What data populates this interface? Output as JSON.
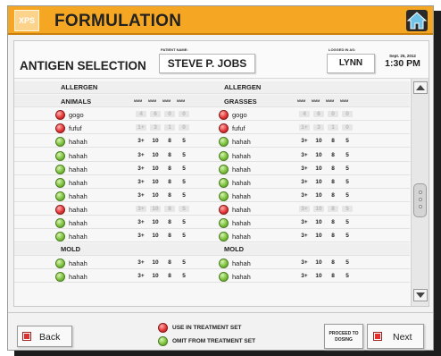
{
  "app": {
    "title": "FORMULATION",
    "logo": "XPS",
    "home_icon": "home-icon",
    "accent": "#f5a623"
  },
  "info": {
    "screen_title": "ANTIGEN SELECTION",
    "patient_label": "PATIENT NAME:",
    "patient_name": "STEVE P. JOBS",
    "login_label": "LOGGED IN AS:",
    "user": "LYNN",
    "date": "Sept. 25, 2012",
    "time": "1:30 PM"
  },
  "groups": [
    {
      "left": "ALLERGEN",
      "right": "ALLERGEN"
    },
    {
      "left": "MOLD",
      "right": "MOLD"
    }
  ],
  "categories": {
    "left": "ANIMALS",
    "right": "GRASSES",
    "columns": [
      "MMM",
      "MMM",
      "MMM",
      "MMM"
    ]
  },
  "rows_left": [
    {
      "status": "red",
      "name": "gogo",
      "values": [
        "4",
        "6",
        "0",
        "0"
      ],
      "dim": true
    },
    {
      "status": "red",
      "name": "fufuf",
      "values": [
        "1+",
        "3",
        "1",
        "0"
      ],
      "dim": true
    },
    {
      "status": "green",
      "name": "hahah",
      "values": [
        "3+",
        "10",
        "8",
        "5"
      ],
      "dim": false
    },
    {
      "status": "green",
      "name": "hahah",
      "values": [
        "3+",
        "10",
        "8",
        "5"
      ],
      "dim": false
    },
    {
      "status": "green",
      "name": "hahah",
      "values": [
        "3+",
        "10",
        "8",
        "5"
      ],
      "dim": false
    },
    {
      "status": "green",
      "name": "hahah",
      "values": [
        "3+",
        "10",
        "8",
        "5"
      ],
      "dim": false
    },
    {
      "status": "green",
      "name": "hahah",
      "values": [
        "3+",
        "10",
        "8",
        "5"
      ],
      "dim": false
    },
    {
      "status": "red",
      "name": "hahah",
      "values": [
        "3+",
        "10",
        "8",
        "5"
      ],
      "dim": true
    },
    {
      "status": "green",
      "name": "hahah",
      "values": [
        "3+",
        "10",
        "8",
        "5"
      ],
      "dim": false
    },
    {
      "status": "green",
      "name": "hahah",
      "values": [
        "3+",
        "10",
        "8",
        "5"
      ],
      "dim": false
    }
  ],
  "rows_right": [
    {
      "status": "red",
      "name": "gogo",
      "values": [
        "4",
        "6",
        "0",
        "0"
      ],
      "dim": true
    },
    {
      "status": "red",
      "name": "fufuf",
      "values": [
        "1+",
        "3",
        "1",
        "0"
      ],
      "dim": true
    },
    {
      "status": "green",
      "name": "hahah",
      "values": [
        "3+",
        "10",
        "8",
        "5"
      ],
      "dim": false
    },
    {
      "status": "green",
      "name": "hahah",
      "values": [
        "3+",
        "10",
        "8",
        "5"
      ],
      "dim": false
    },
    {
      "status": "green",
      "name": "hahah",
      "values": [
        "3+",
        "10",
        "8",
        "5"
      ],
      "dim": false
    },
    {
      "status": "green",
      "name": "hahah",
      "values": [
        "3+",
        "10",
        "8",
        "5"
      ],
      "dim": false
    },
    {
      "status": "green",
      "name": "hahah",
      "values": [
        "3+",
        "10",
        "8",
        "5"
      ],
      "dim": false
    },
    {
      "status": "red",
      "name": "hahah",
      "values": [
        "3+",
        "10",
        "8",
        "5"
      ],
      "dim": true
    },
    {
      "status": "green",
      "name": "hahah",
      "values": [
        "3+",
        "10",
        "8",
        "5"
      ],
      "dim": false
    },
    {
      "status": "green",
      "name": "hahah",
      "values": [
        "3+",
        "10",
        "8",
        "5"
      ],
      "dim": false
    }
  ],
  "mold_left": [
    {
      "status": "green",
      "name": "hahah",
      "values": [
        "3+",
        "10",
        "8",
        "5"
      ],
      "dim": false
    },
    {
      "status": "green",
      "name": "hahah",
      "values": [
        "3+",
        "10",
        "8",
        "5"
      ],
      "dim": false
    }
  ],
  "mold_right": [
    {
      "status": "green",
      "name": "hahah",
      "values": [
        "3+",
        "10",
        "8",
        "5"
      ],
      "dim": false
    },
    {
      "status": "green",
      "name": "hahah",
      "values": [
        "3+",
        "10",
        "8",
        "5"
      ],
      "dim": false
    }
  ],
  "legend": {
    "red": "USE IN TREATMENT SET",
    "green": "OMIT FROM TREATMENT SET"
  },
  "footer": {
    "back": "Back",
    "proceed": "PROCEED TO DOSING",
    "next": "Next"
  },
  "scroll_icons": {
    "up": "scroll-up-arrow-icon",
    "down": "scroll-down-arrow-icon"
  }
}
